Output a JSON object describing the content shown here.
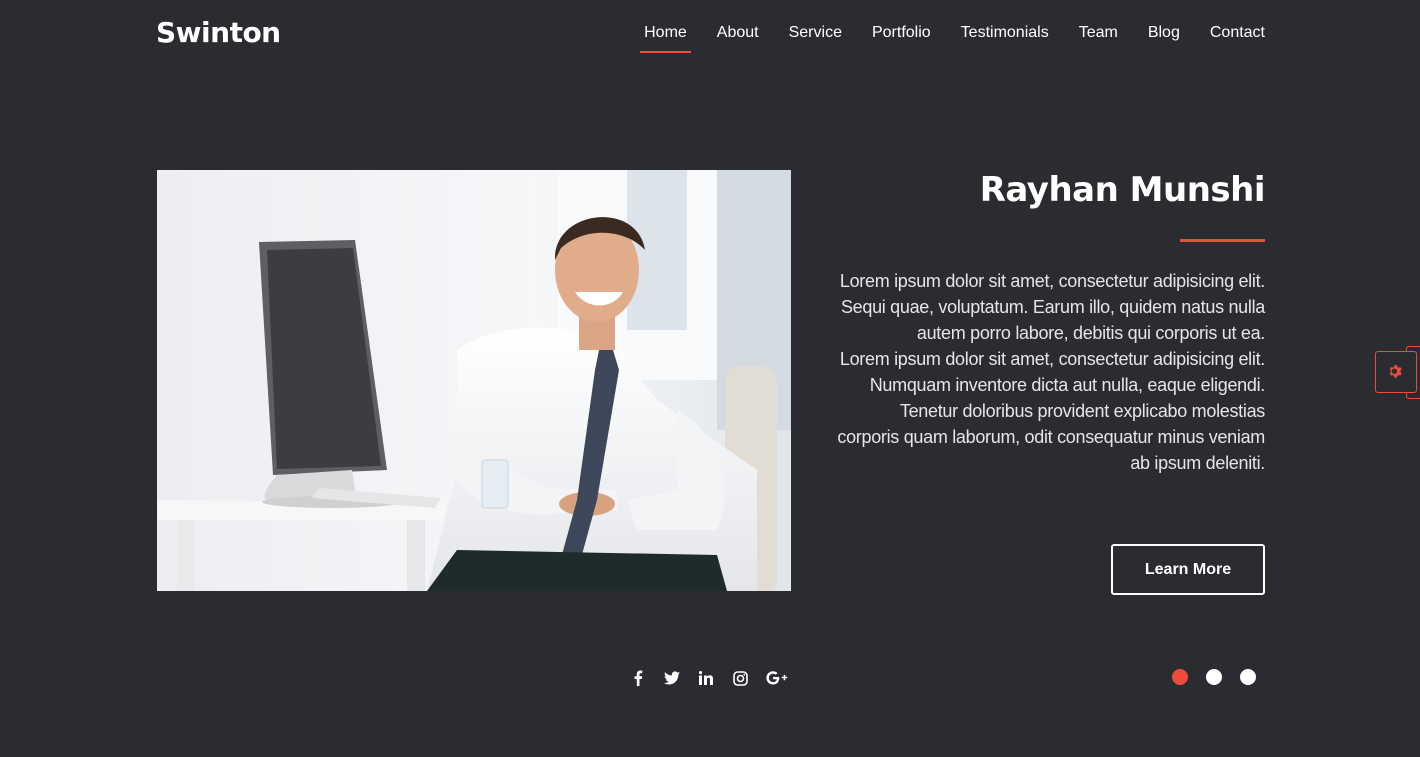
{
  "header": {
    "brand": "Swinton",
    "nav": [
      {
        "label": "Home",
        "active": true
      },
      {
        "label": "About"
      },
      {
        "label": "Service"
      },
      {
        "label": "Portfolio"
      },
      {
        "label": "Testimonials"
      },
      {
        "label": "Team"
      },
      {
        "label": "Blog"
      },
      {
        "label": "Contact"
      }
    ]
  },
  "hero": {
    "name": "Rayhan Munshi",
    "text_lines": [
      "Lorem ipsum dolor sit amet, consectetur adipisicing elit.",
      "Sequi quae, voluptatum. Earum illo, quidem natus nulla",
      "autem porro labore, debitis qui corporis ut ea.",
      "Lorem ipsum dolor sit amet, consectetur adipisicing elit.",
      "Numquam inventore dicta aut nulla, eaque eligendi.",
      "Tenetur doloribus provident explicabo molestias",
      "corporis quam laborum, odit consequatur minus veniam",
      "ab ipsum deleniti."
    ],
    "button_label": "Learn More"
  },
  "social": [
    "facebook-icon",
    "twitter-icon",
    "linkedin-icon",
    "instagram-icon",
    "google-plus-icon"
  ],
  "slider": {
    "count": 3,
    "active_index": 0
  },
  "colors": {
    "background": "#2b2c31",
    "accent": "#ef4b3b",
    "text": "#ffffff"
  }
}
